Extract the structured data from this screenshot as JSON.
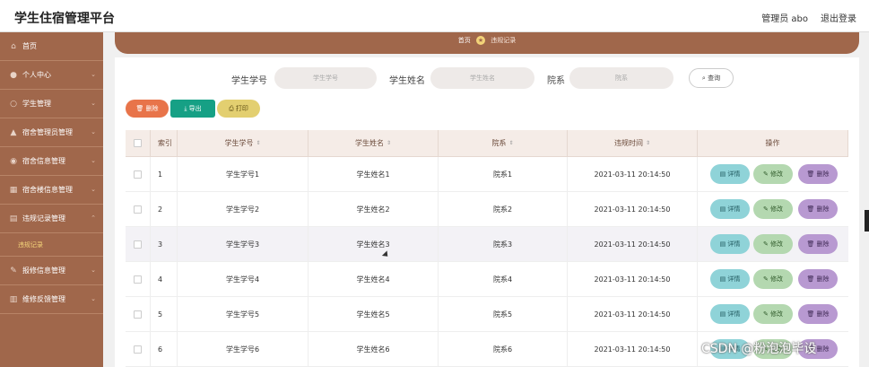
{
  "app": {
    "title": "学生住宿管理平台",
    "user_label": "管理员 abo",
    "logout_label": "退出登录"
  },
  "sidebar": {
    "items": [
      {
        "label": "首页",
        "icon": "home-icon"
      },
      {
        "label": "个人中心",
        "icon": "user-icon"
      },
      {
        "label": "学生管理",
        "icon": "student-icon"
      },
      {
        "label": "宿舍管理员管理",
        "icon": "admin-icon"
      },
      {
        "label": "宿舍信息管理",
        "icon": "location-icon"
      },
      {
        "label": "宿舍楼信息管理",
        "icon": "building-icon"
      },
      {
        "label": "违规记录管理",
        "icon": "record-icon"
      },
      {
        "label": "报修信息管理",
        "icon": "repair-icon"
      },
      {
        "label": "维修反馈管理",
        "icon": "feedback-icon"
      }
    ],
    "active_sub": "违规记录"
  },
  "breadcrumb": {
    "home": "首页",
    "current": "违规记录"
  },
  "search": {
    "fields": [
      {
        "label": "学生学号",
        "placeholder": "学生学号"
      },
      {
        "label": "学生姓名",
        "placeholder": "学生姓名"
      },
      {
        "label": "院系",
        "placeholder": "院系"
      }
    ],
    "button_label": "查询"
  },
  "actions": {
    "delete_label": "删除",
    "export_label": "导出",
    "print_label": "打印"
  },
  "table": {
    "columns": [
      "索引",
      "学生学号",
      "学生姓名",
      "院系",
      "违规时间",
      "操作"
    ],
    "rows": [
      {
        "index": "1",
        "student_no": "学生学号1",
        "name": "学生姓名1",
        "dept": "院系1",
        "time": "2021-03-11 20:14:50"
      },
      {
        "index": "2",
        "student_no": "学生学号2",
        "name": "学生姓名2",
        "dept": "院系2",
        "time": "2021-03-11 20:14:50"
      },
      {
        "index": "3",
        "student_no": "学生学号3",
        "name": "学生姓名3",
        "dept": "院系3",
        "time": "2021-03-11 20:14:50"
      },
      {
        "index": "4",
        "student_no": "学生学号4",
        "name": "学生姓名4",
        "dept": "院系4",
        "time": "2021-03-11 20:14:50"
      },
      {
        "index": "5",
        "student_no": "学生学号5",
        "name": "学生姓名5",
        "dept": "院系5",
        "time": "2021-03-11 20:14:50"
      },
      {
        "index": "6",
        "student_no": "学生学号6",
        "name": "学生姓名6",
        "dept": "院系6",
        "time": "2021-03-11 20:14:50"
      }
    ],
    "ops": {
      "detail": "详情",
      "edit": "修改",
      "delete": "删除"
    }
  },
  "watermark": "CSDN @粉泡泡毕设",
  "colors": {
    "sidebar": "#a0674b",
    "accent_yellow": "#f4d479",
    "export_btn": "#16a085"
  }
}
